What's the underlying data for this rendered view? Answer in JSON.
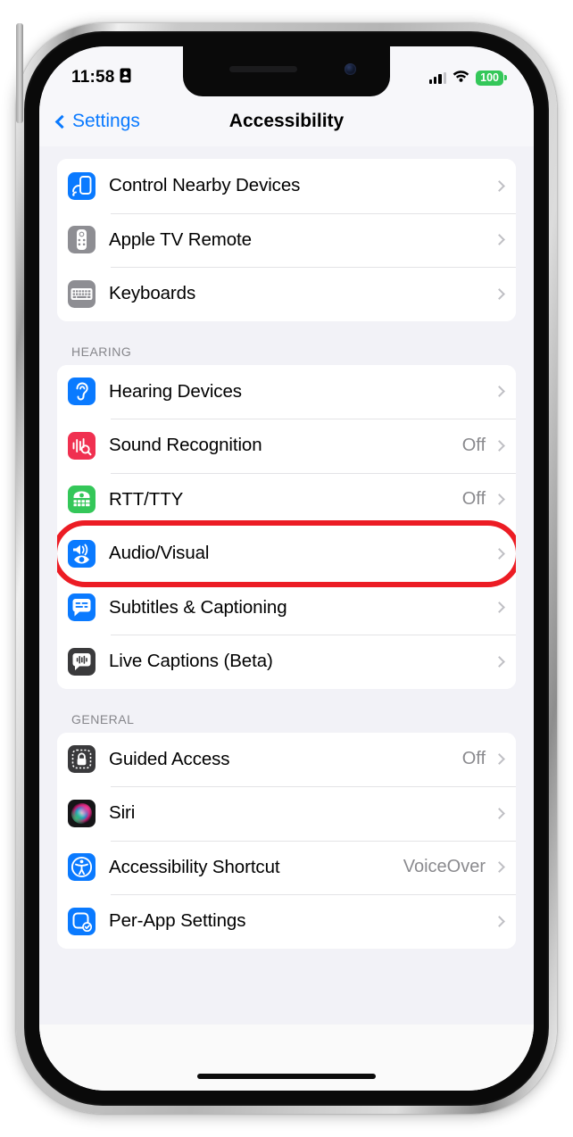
{
  "status_bar": {
    "time": "11:58",
    "location_icon": "id-card-icon",
    "signal_icon": "cellular-signal-icon",
    "wifi_icon": "wifi-icon",
    "battery_level": "100"
  },
  "nav": {
    "back_label": "Settings",
    "back_icon": "chevron-left-icon",
    "title": "Accessibility"
  },
  "groups": [
    {
      "header": "",
      "rows": [
        {
          "label": "Control Nearby Devices",
          "value": "",
          "icon": "control-nearby-devices-icon",
          "highlighted": false
        },
        {
          "label": "Apple TV Remote",
          "value": "",
          "icon": "apple-tv-remote-icon",
          "highlighted": false
        },
        {
          "label": "Keyboards",
          "value": "",
          "icon": "keyboards-icon",
          "highlighted": false
        }
      ]
    },
    {
      "header": "HEARING",
      "rows": [
        {
          "label": "Hearing Devices",
          "value": "",
          "icon": "hearing-devices-icon",
          "highlighted": false
        },
        {
          "label": "Sound Recognition",
          "value": "Off",
          "icon": "sound-recognition-icon",
          "highlighted": false
        },
        {
          "label": "RTT/TTY",
          "value": "Off",
          "icon": "rtt-tty-icon",
          "highlighted": false
        },
        {
          "label": "Audio/Visual",
          "value": "",
          "icon": "audio-visual-icon",
          "highlighted": true
        },
        {
          "label": "Subtitles & Captioning",
          "value": "",
          "icon": "subtitles-captioning-icon",
          "highlighted": false
        },
        {
          "label": "Live Captions (Beta)",
          "value": "",
          "icon": "live-captions-icon",
          "highlighted": false
        }
      ]
    },
    {
      "header": "GENERAL",
      "rows": [
        {
          "label": "Guided Access",
          "value": "Off",
          "icon": "guided-access-icon",
          "highlighted": false
        },
        {
          "label": "Siri",
          "value": "",
          "icon": "siri-icon",
          "highlighted": false
        },
        {
          "label": "Accessibility Shortcut",
          "value": "VoiceOver",
          "icon": "accessibility-shortcut-icon",
          "highlighted": false
        },
        {
          "label": "Per-App Settings",
          "value": "",
          "icon": "per-app-settings-icon",
          "highlighted": false
        }
      ]
    }
  ],
  "colors": {
    "accent_blue": "#0a7aff",
    "icon_blue": "#0a7aff",
    "icon_gray": "#8e8e93",
    "icon_dark": "#3a3a3c",
    "icon_red": "#f03050",
    "icon_green": "#34c759",
    "battery_green": "#34c759",
    "highlight_red": "#ec1c24",
    "secondary_text": "#8a8a8e",
    "group_background": "#f2f2f7"
  },
  "home_indicator": "home-indicator"
}
